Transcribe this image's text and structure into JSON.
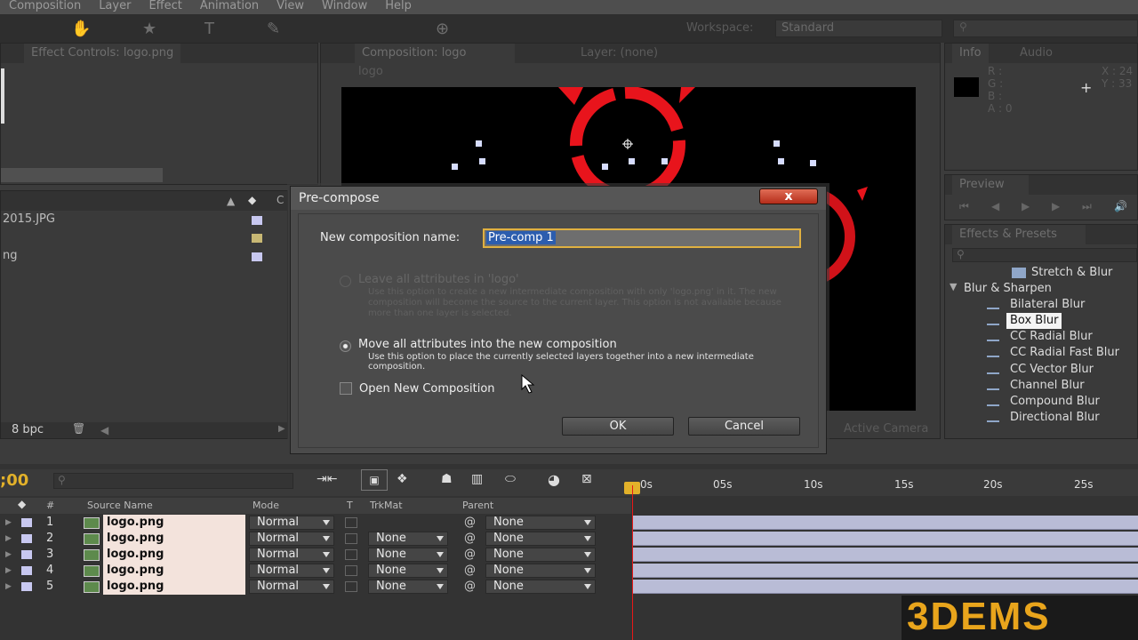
{
  "menubar": {
    "items": [
      "Composition",
      "Layer",
      "Effect",
      "Animation",
      "View",
      "Window",
      "Help"
    ]
  },
  "workspace": {
    "label": "Workspace:",
    "value": "Standard"
  },
  "effect_controls": {
    "tab": "Effect Controls: logo.png"
  },
  "project": {
    "items": [
      {
        "name": "2015.JPG",
        "color": "#c8c8f0"
      },
      {
        "name": "",
        "color": "#c8b874"
      },
      {
        "name": "ng",
        "color": "#c8c8f0"
      }
    ],
    "col_c": "C",
    "bpc": "8 bpc"
  },
  "composition": {
    "tab": "Composition: logo",
    "layer_tab": "Layer: (none)",
    "breadcrumb": "logo",
    "camera": "Active Camera"
  },
  "info": {
    "tab": "Info",
    "audio_tab": "Audio",
    "labels": [
      "R :",
      "G :",
      "B :",
      "A : 0"
    ],
    "coords": [
      "X : 24",
      "Y : 33"
    ]
  },
  "preview": {
    "tab": "Preview"
  },
  "effects_presets": {
    "tab": "Effects & Presets",
    "category_above": "Stretch & Blur",
    "group": "Blur & Sharpen",
    "items": [
      "Bilateral Blur",
      "Box Blur",
      "CC Radial Blur",
      "CC Radial Fast Blur",
      "CC Vector Blur",
      "Channel Blur",
      "Compound Blur",
      "Directional Blur"
    ],
    "selected": "Box Blur"
  },
  "timeline": {
    "timecode": ";00",
    "headers": {
      "num": "#",
      "source": "Source Name",
      "mode": "Mode",
      "t": "T",
      "trkmat": "TrkMat",
      "parent": "Parent"
    },
    "ruler": [
      "0s",
      "05s",
      "10s",
      "15s",
      "20s",
      "25s"
    ],
    "layers": [
      {
        "num": "1",
        "name": "logo.png",
        "mode": "Normal",
        "trkmat": "",
        "parent": "None"
      },
      {
        "num": "2",
        "name": "logo.png",
        "mode": "Normal",
        "trkmat": "None",
        "parent": "None"
      },
      {
        "num": "3",
        "name": "logo.png",
        "mode": "Normal",
        "trkmat": "None",
        "parent": "None"
      },
      {
        "num": "4",
        "name": "logo.png",
        "mode": "Normal",
        "trkmat": "None",
        "parent": "None"
      },
      {
        "num": "5",
        "name": "logo.png",
        "mode": "Normal",
        "trkmat": "None",
        "parent": "None"
      }
    ]
  },
  "dialog": {
    "title": "Pre-compose",
    "close": "x",
    "name_label": "New composition name:",
    "name_value": "Pre-comp 1",
    "option1_label": "Leave all attributes in 'logo'",
    "option1_desc": "Use this option to create a new intermediate composition with only 'logo.png' in it. The new composition will become the source to the current layer. This option is not available because more than one layer is selected.",
    "option2_label": "Move all attributes into the new composition",
    "option2_desc": "Use this option to place the currently selected layers together into a new intermediate composition.",
    "open_new_label": "Open New Composition",
    "ok": "OK",
    "cancel": "Cancel"
  },
  "watermark": {
    "text": "3DEMS"
  }
}
